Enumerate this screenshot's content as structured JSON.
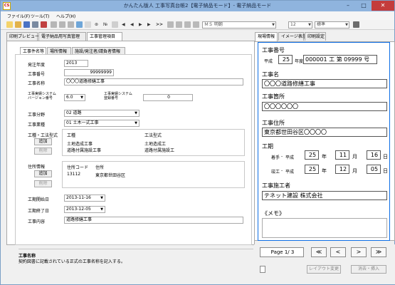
{
  "window": {
    "title": "かんたん版人 工事写真台帳2【電子納品モード】- 電子納品モード",
    "app_icon_text": "CS"
  },
  "menu": [
    "ファイル(F)",
    "ツール(T)",
    "ヘルプ(H)"
  ],
  "toolbar": {
    "jump_arrows": ">>",
    "no_label": "№",
    "font_name": "ＭＳ 明朝",
    "font_size": "12",
    "style": "標準"
  },
  "left_tabs": [
    "印刷プレビュー",
    "電子納品用写真管理",
    "工事管理項目"
  ],
  "inner_tabs": [
    "工事件名等",
    "場所情報",
    "施設/発注者/請負者情報"
  ],
  "form": {
    "order_year_label": "発注年度",
    "order_year": "2013",
    "number_label": "工事番号",
    "number": "99999999",
    "name_label": "工事名称",
    "name": "〇〇〇道路修繕工事",
    "sys_ver_label1": "工事実績システム",
    "sys_ver_label2": "バージョン番号",
    "sys_ver": "6.0",
    "sys_reg_label1": "工事実績システム",
    "sys_reg_label2": "登録番号",
    "sys_reg": "0",
    "field_label": "工事分野",
    "field": "02  道路",
    "industry_label": "工事業種",
    "industry": "01  土木一式工事",
    "type_label": "工種・工法型式",
    "type_headers": [
      "工種",
      "工法型式"
    ],
    "type_rows": [
      [
        "土地造成工事",
        "土地造成工"
      ],
      [
        "道路付属施設工事",
        "道路付属施設工"
      ]
    ],
    "add_label": "追加",
    "delete_label": "削除",
    "address_label": "住所情報",
    "address_headers": [
      "住所コード",
      "住所"
    ],
    "address_rows": [
      [
        "13112",
        "東京都世田谷区"
      ]
    ],
    "start_label": "工期開始日",
    "start": "2013-11-16",
    "end_label": "工期終了日",
    "end": "2013-12-05",
    "content_label": "工事内容",
    "content": "道路修繕工事"
  },
  "description": {
    "title": "工事名称",
    "text": "契約図書に記載されている正式の工事名称を記入する。"
  },
  "right_tabs": [
    "現場情報",
    "イメージ表示",
    "印刷設定"
  ],
  "card": {
    "number_label": "工事番号",
    "era": "平成",
    "year": "25",
    "year_suffix": "年度",
    "number_value": "000001 工 第 09999 号",
    "name_label": "工事名",
    "name_value": "〇〇〇道路修繕工事",
    "place_label": "工事箇所",
    "place_value": "〇〇〇〇〇〇",
    "address_label": "工事住所",
    "address_value": "東京都世田谷区〇〇〇〇",
    "period_label": "工期",
    "start_label": "着手",
    "end_label": "竣工",
    "sep": "-",
    "start_y": "25",
    "start_m": "11",
    "start_d": "16",
    "end_y": "25",
    "end_m": "12",
    "end_d": "05",
    "nen": "年",
    "tsuki": "月",
    "hi": "日",
    "contractor_label": "工事施工者",
    "contractor_value": "テネット建設 株式会社",
    "memo_label": "《メモ》"
  },
  "nav": {
    "page": "Page 1/ 3",
    "first": "≪",
    "prev": "<",
    "next": ">",
    "last": "≫",
    "layout_button": "レイアウト変更",
    "delete_insert_button": "消去・挿入"
  },
  "colors": {
    "titlebar": "#8fb4de",
    "card_border": "#0d6ee6",
    "close": "#c43c3c"
  }
}
